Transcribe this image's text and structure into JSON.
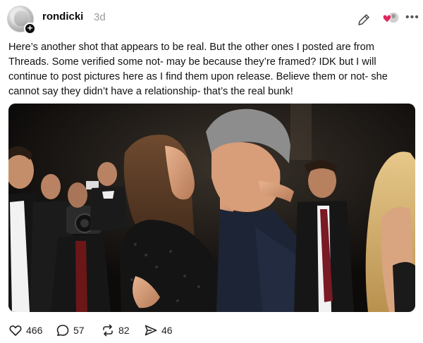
{
  "post": {
    "username": "rondicki",
    "time": "3d",
    "body": "Here’s another shot that appears to be real. But the other ones I posted are from Threads. Some verified some not- may be because they’re framed? IDK but I will continue to post pictures here as I find them upon release. Believe them or not- she cannot say they didn’t have a relationship- that’s the real bunk!"
  },
  "actions": {
    "likes": "466",
    "replies": "57",
    "reposts": "82",
    "shares": "46"
  },
  "icons": {
    "edit": "pencil-icon",
    "more": "more-horizontal-icon",
    "like": "heart-icon",
    "reply": "comment-bubble-icon",
    "repost": "repost-icon",
    "share": "send-icon"
  }
}
